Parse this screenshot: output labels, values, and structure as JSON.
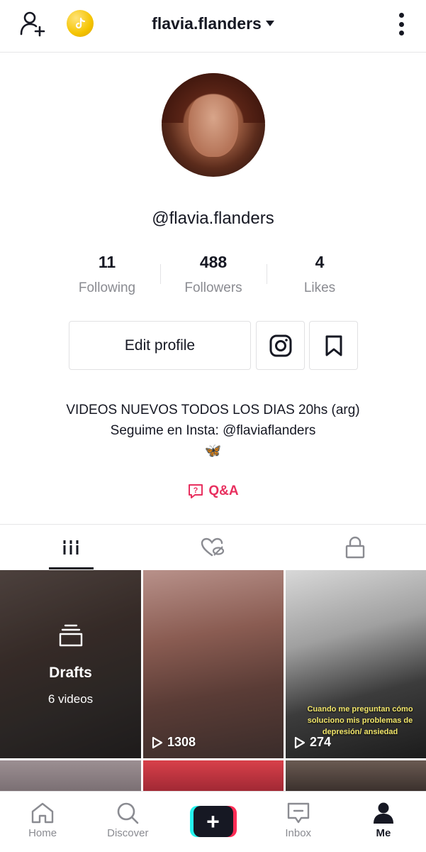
{
  "header": {
    "username": "flavia.flanders",
    "add_user_icon": "person-add-icon",
    "coin_icon": "tiktok-coin-icon",
    "more_icon": "more-vertical-icon"
  },
  "profile": {
    "handle": "@flavia.flanders",
    "stats": [
      {
        "num": "11",
        "label": "Following"
      },
      {
        "num": "488",
        "label": "Followers"
      },
      {
        "num": "4",
        "label": "Likes"
      }
    ],
    "edit_label": "Edit profile",
    "bio_line1": "VIDEOS NUEVOS TODOS LOS DIAS 20hs (arg)",
    "bio_line2": "Seguime en Insta: @flaviaflanders",
    "bio_emoji": "🦋",
    "qa_label": "Q&A"
  },
  "tabs": [
    {
      "icon": "videos-grid-icon"
    },
    {
      "icon": "liked-hidden-icon"
    },
    {
      "icon": "private-lock-icon"
    }
  ],
  "grid": {
    "drafts_title": "Drafts",
    "drafts_count": "6 videos",
    "video2_views": "1308",
    "video3_views": "274",
    "video3_caption": "Cuando me preguntan cómo soluciono mis problemas de depresión/ ansiedad"
  },
  "nav": {
    "home": "Home",
    "discover": "Discover",
    "inbox": "Inbox",
    "me": "Me"
  },
  "colors": {
    "accent": "#e8305f",
    "text": "#161823",
    "muted": "#8a8b91"
  }
}
